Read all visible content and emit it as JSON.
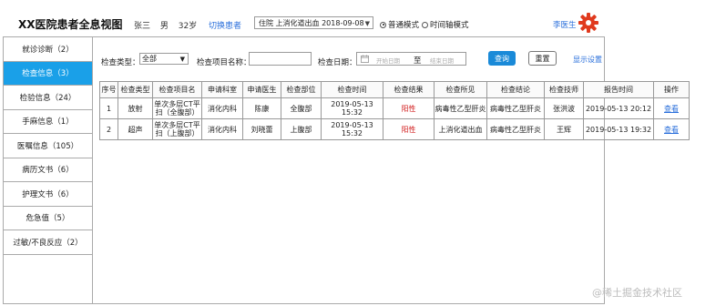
{
  "header": {
    "app_title": "XX医院患者全息视图",
    "patient_name": "张三",
    "patient_gender": "男",
    "patient_age": "32岁",
    "switch_patient": "切换患者",
    "visit_selected": "住院  上消化道出血  2018-09-08",
    "mode_normal": "普通模式",
    "mode_timeline": "时间轴模式",
    "doctor_name": "李医生",
    "gear_color": "#e03a1e"
  },
  "sidebar": {
    "items": [
      {
        "label": "就诊诊断（2）"
      },
      {
        "label": "检查信息（3）"
      },
      {
        "label": "检验信息（24）"
      },
      {
        "label": "手麻信息（1）"
      },
      {
        "label": "医嘱信息（105）"
      },
      {
        "label": "病历文书（6）"
      },
      {
        "label": "护理文书（6）"
      },
      {
        "label": "危急值（5）"
      },
      {
        "label": "过敏/不良反应（2）"
      }
    ],
    "active_index": 1,
    "active_color": "#1aa0e8"
  },
  "filter": {
    "type_label": "检查类型：",
    "type_value": "全部",
    "name_label": "检查项目名称：",
    "name_value": "",
    "date_label": "检查日期：",
    "start_placeholder": "开始日期",
    "to_label": "至",
    "end_placeholder": "结束日期",
    "query_button": "查询",
    "reset_button": "重置",
    "show_settings": "显示设置"
  },
  "table": {
    "columns": [
      "序号",
      "检查类型",
      "检查项目名",
      "申请科室",
      "申请医生",
      "检查部位",
      "检查时间",
      "检查结果",
      "检查所见",
      "检查结论",
      "检查技师",
      "报告时间",
      "操作"
    ],
    "rows": [
      {
        "no": "1",
        "type": "放射",
        "item": "单次多层CT平扫（全腹部）",
        "dept": "消化内科",
        "doctor": "陈康",
        "part": "全腹部",
        "time": "2019-05-13 15:32",
        "result": "阳性",
        "finding": "病毒性乙型肝炎",
        "conclusion": "病毒性乙型肝炎",
        "tech": "张洪波",
        "report_time": "2019-05-13 20:12",
        "action": "查看"
      },
      {
        "no": "2",
        "type": "超声",
        "item": "单次多层CT平扫（上腹部）",
        "dept": "消化内科",
        "doctor": "刘晓蕾",
        "part": "上腹部",
        "time": "2019-05-13 15:32",
        "result": "阳性",
        "finding": "上消化道出血",
        "conclusion": "病毒性乙型肝炎",
        "tech": "王辉",
        "report_time": "2019-05-13 19:32",
        "action": "查看"
      }
    ],
    "positive_color": "#d21f1f"
  },
  "watermark": "@稀土掘金技术社区"
}
